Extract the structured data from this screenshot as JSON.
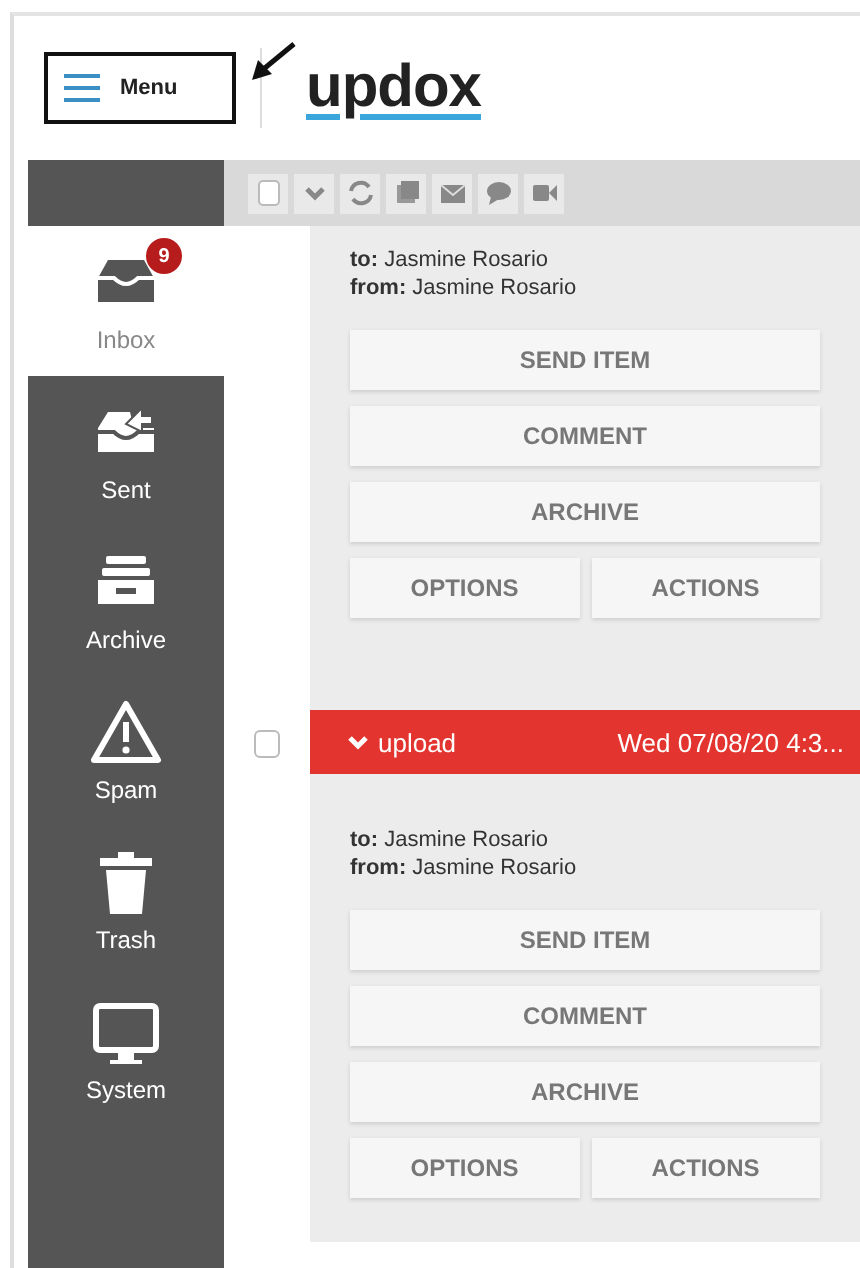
{
  "header": {
    "menu_label": "Menu",
    "logo": "updox"
  },
  "sidebar": {
    "items": [
      {
        "label": "Inbox",
        "selected": true,
        "badge": "9"
      },
      {
        "label": "Sent",
        "selected": false
      },
      {
        "label": "Archive",
        "selected": false
      },
      {
        "label": "Spam",
        "selected": false
      },
      {
        "label": "Trash",
        "selected": false
      },
      {
        "label": "System",
        "selected": false
      }
    ]
  },
  "messages": [
    {
      "to": "**to:** Jasmine Rosario",
      "from": "**from:** Jasmine Rosario",
      "buttons": [
        "SEND ITEM",
        "COMMENT",
        "ARCHIVE",
        "OPTIONS",
        "ACTIONS"
      ]
    },
    {
      "subject": "upload",
      "date": "Wed 07/08/20 4:3...",
      "checked": false,
      "to": "**to:** Jasmine Rosario",
      "from": "**from:** Jasmine Rosario",
      "buttons": [
        "SEND ITEM",
        "COMMENT",
        "ARCHIVE",
        "OPTIONS",
        "ACTIONS"
      ]
    }
  ]
}
